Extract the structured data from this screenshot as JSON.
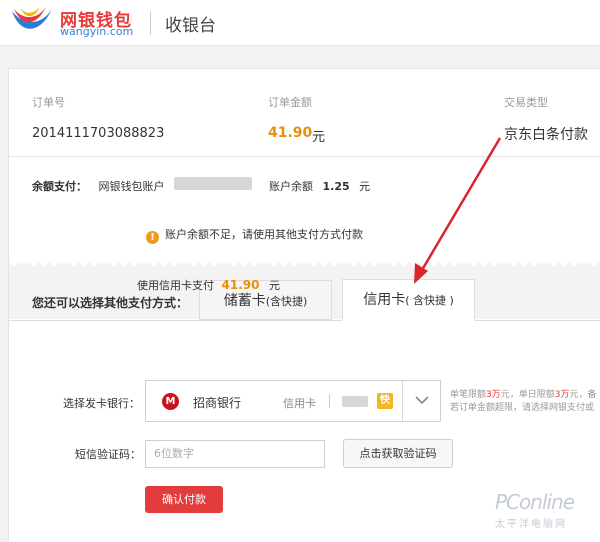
{
  "header": {
    "brand_cn": "网银钱包",
    "brand_en": "wangyin.com",
    "title": "收银台"
  },
  "order": {
    "number_label": "订单号",
    "number": "2014111703088823",
    "amount_label": "订单金额",
    "amount": "41.90",
    "amount_unit": "元",
    "type_label": "交易类型",
    "type": "京东白条付款"
  },
  "balance": {
    "pay_label": "余额支付：",
    "account_label": "网银钱包账户",
    "balance_label": "账户余额",
    "balance_value": "1.25",
    "balance_unit": "元"
  },
  "warning": {
    "text": "账户余额不足，请使用其他支付方式付款"
  },
  "payment": {
    "choose_label": "您还可以选择其他支付方式：",
    "tabs": [
      {
        "label": "储蓄卡",
        "sub": "(含快捷)"
      },
      {
        "label": "信用卡",
        "sub": "( 含快捷 )"
      }
    ],
    "use_credit_prefix": "使用信用卡支付",
    "use_credit_amount": "41.90",
    "use_credit_unit": "元"
  },
  "form": {
    "bank_label": "选择发卡银行：",
    "bank_name": "招商银行",
    "card_type": "信用卡",
    "quick_badge": "快",
    "limit_line1_a": "单笔限额",
    "limit_line1_b": "3万",
    "limit_line1_c": "元，单日限额",
    "limit_line1_d": "3万",
    "limit_line1_e": "元，备",
    "limit_line2": "若订单金额超限，请选择网银支付或",
    "sms_label": "短信验证码：",
    "sms_placeholder": "6位数字",
    "sms_button": "点击获取验证码",
    "confirm_button": "确认付款"
  },
  "watermark": {
    "text": "PConline",
    "sub": "太平洋电脑网"
  },
  "colors": {
    "accent_orange": "#e98f0b",
    "brand_red": "#e8393a",
    "confirm_red": "#e23c3c",
    "warn_orange": "#f09a1d"
  }
}
